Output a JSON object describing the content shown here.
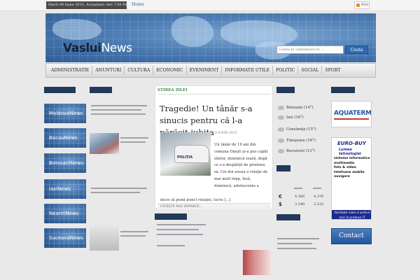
{
  "topbar": {
    "date": "Marti 09 Iunie 2015, Actualizat: Ieri 7:56 Pm",
    "home_link": "Home",
    "rss_label": "RSS"
  },
  "header": {
    "logo_part1": "Vaslui",
    "logo_part2": "News",
    "search_placeholder": "Cauta in vasluinews.ro ...",
    "search_button": "Cauta"
  },
  "nav": {
    "items": [
      "ADMINISTRATIE",
      "ANUNTURI",
      "CULTURA",
      "ECONOMIC",
      "EVENIMENT",
      "INFORMATII UTILE",
      "POLITIC",
      "SOCIAL",
      "SPORT"
    ]
  },
  "cities": [
    "MoldovaNews",
    "BacauNews",
    "BotosaniNews",
    "IasiNews",
    "NeamtNews",
    "SuceavaNews"
  ],
  "feature": {
    "tag": "STIREA ZILEI",
    "title": "Tragedie! Un tânăr s-a sinucis pentru că l-a părăsit iubita",
    "date": "8 IUNIE 2015",
    "image_label": "POLIŢIA",
    "body": "Un tânăr de 19 ani din comuna Oşeşti şi-a pus capăt zilelor, duminică seară, după ce s-a despărţit de prietena sa. Cei doi aveau o relaţie de mai mult timp, însă, duminică, adolescenta a",
    "body_tail": "decis să pună punct relaţiei, lucru [...]",
    "more": "CITEŞTE MAI DEPARTE..."
  },
  "weather": [
    "Botosani (14°)",
    "Iasi (16°)",
    "Constanţa (15°)",
    "Timişoara (16°)",
    "Bucuresti (13°)"
  ],
  "fx": {
    "rows": [
      {
        "symbol": "€",
        "buy": "4.385",
        "sell": "4.376"
      },
      {
        "symbol": "$",
        "buy": "3.240",
        "sell": "3.232"
      }
    ]
  },
  "ads": {
    "aqua": "AQUATERM",
    "euro_title": "EURO-BUY",
    "euro_sub": "Lumea tehnologiei",
    "euro_lines": [
      "sisteme informatice",
      "multimedia",
      "foto & video",
      "telefoane mobile",
      "navigare"
    ],
    "euro_footer": "Varietate mare si preturi mici la produse IT",
    "contact": "Contact"
  },
  "colors": {
    "header_blue": "#4f7fb6",
    "nav_gray": "#d9d9d9",
    "feature_tag_green": "#3c8a3c",
    "contact_blue": "#23559b"
  }
}
